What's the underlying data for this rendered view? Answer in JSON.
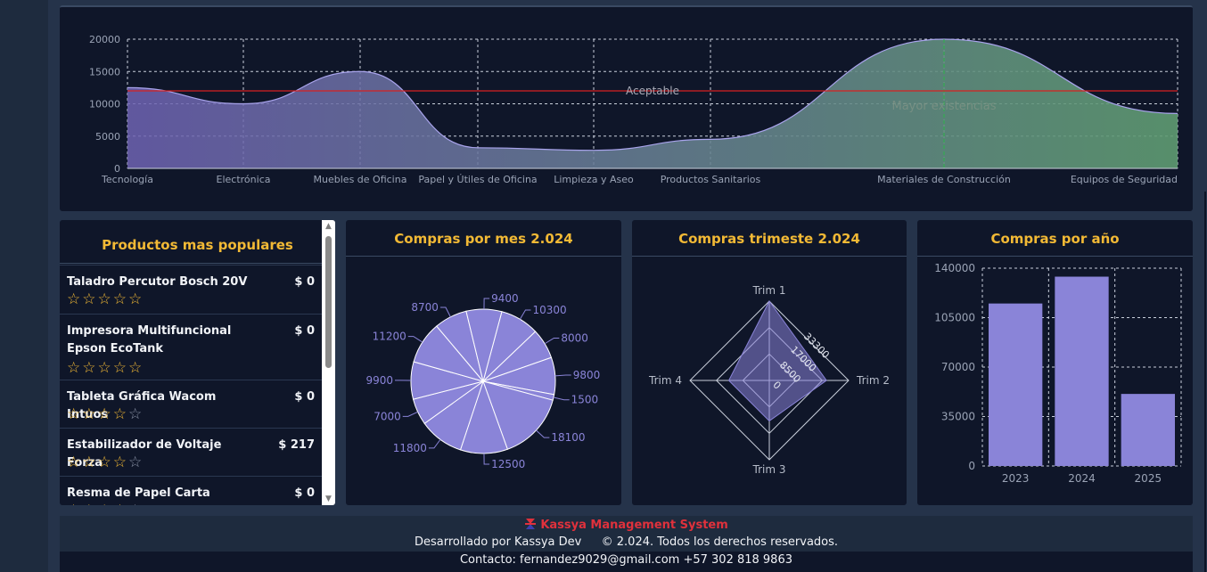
{
  "area_chart": {
    "type": "area",
    "categories": [
      "Tecnología",
      "Electrónica",
      "Muebles de Oficina",
      "Papel y Útiles de Oficina",
      "Limpieza y Aseo",
      "Productos Sanitarios",
      "Materiales de Construcción",
      "Equipos de Seguridad"
    ],
    "values": [
      12500,
      10000,
      15000,
      3200,
      2800,
      4500,
      20000,
      8500
    ],
    "ylim": [
      0,
      20000
    ],
    "yticks": [
      "20000",
      "15000",
      "10000",
      "5000",
      "0"
    ],
    "markline_label": "Aceptable",
    "markline_value": 12000,
    "markline_color": "#d62121",
    "max_label": "Mayor existencias",
    "grad_start": "#6f63b3",
    "grad_end": "#5f9c72"
  },
  "products": {
    "title": "Productos mas populares",
    "items": [
      {
        "name": "Taladro Percutor Bosch 20V",
        "price": "$ 0",
        "rating": 5
      },
      {
        "name": "Impresora Multifuncional Epson EcoTank",
        "price": "$ 0",
        "rating": 5
      },
      {
        "name": "Tableta Gráfica Wacom Intuos",
        "price": "$ 0",
        "rating": 4
      },
      {
        "name": "Estabilizador de Voltaje Forza",
        "price": "$ 217",
        "rating": 4
      },
      {
        "name": "Resma de Papel Carta",
        "price": "$ 0",
        "rating": 4
      }
    ]
  },
  "pie": {
    "title": "Compras por mes 2.024",
    "chart_data": {
      "type": "pie",
      "values": [
        10300,
        8000,
        9800,
        1500,
        18100,
        12500,
        11800,
        7000,
        9900,
        11200,
        8700,
        9400
      ],
      "color": "#8a84d8"
    }
  },
  "radar": {
    "title": "Compras trimeste 2.024",
    "chart_data": {
      "type": "radar",
      "indicators": [
        "Trim 1",
        "Trim 2",
        "Trim 3",
        "Trim 4"
      ],
      "values": [
        33300,
        24000,
        17000,
        17000
      ],
      "max": 33300,
      "ring_labels": [
        "0",
        "8500",
        "17000",
        "33300"
      ],
      "color": "#8a84d8"
    }
  },
  "bar": {
    "title": "Compras por año",
    "chart_data": {
      "type": "bar",
      "categories": [
        "2023",
        "2024",
        "2025"
      ],
      "values": [
        115000,
        134000,
        51000
      ],
      "ylim": [
        0,
        140000
      ],
      "yticks": [
        "140000",
        "105000",
        "70000",
        "35000",
        "0"
      ],
      "color": "#8a84d8"
    }
  },
  "footer": {
    "brand": "Kassya Management System",
    "line1_left": "Desarrollado por Kassya Dev",
    "line1_right": "© 2.024. Todos los derechos reservados.",
    "line2": "Contacto: fernandez9029@gmail.com   +57 302 818 9863",
    "logo_color": "#e0313c"
  }
}
